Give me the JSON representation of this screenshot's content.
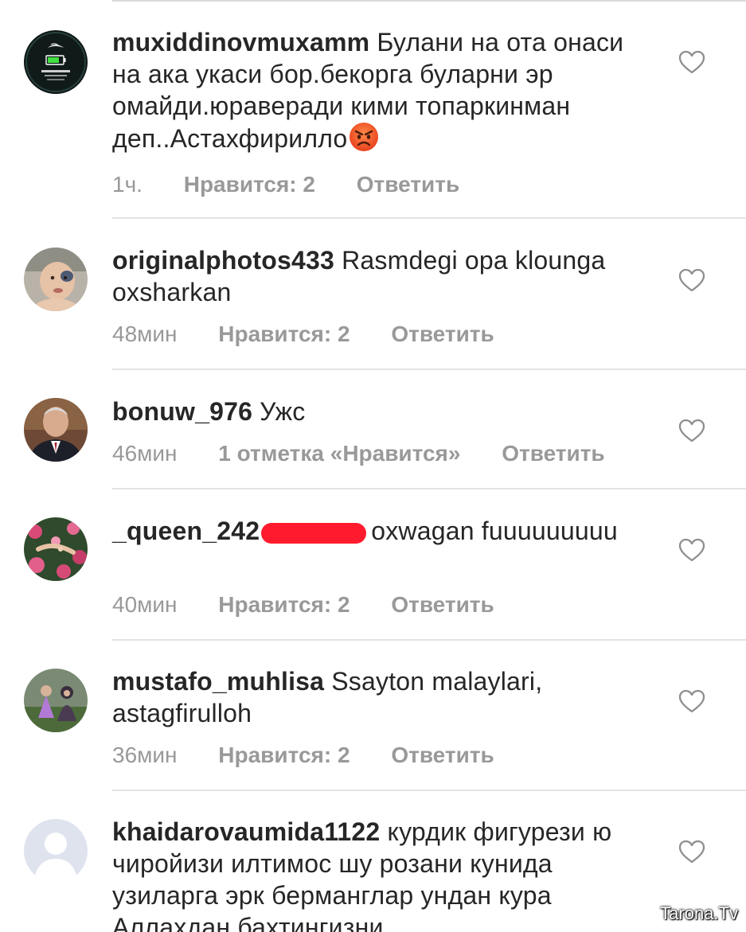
{
  "comments": [
    {
      "username": "muxiddinovmuxamm",
      "text": "Булани на ота онаси на ака укаси бор.бекорга буларни эр омайди.юраверади кими топаркинман деп..Астахфирилло",
      "emoji": "angry-face",
      "time": "1ч.",
      "likes": "Нравится: 2",
      "reply": "Ответить"
    },
    {
      "username": "originalphotos433",
      "text": "Rasmdegi opa klounga oxsharkan",
      "time": "48мин",
      "likes": "Нравится: 2",
      "reply": "Ответить"
    },
    {
      "username": "bonuw_976",
      "text": "Ужс",
      "time": "46мин",
      "likes": "1 отметка «Нравится»",
      "reply": "Ответить"
    },
    {
      "username": "_queen_242",
      "text": "oxwagan fuuuuuuuuu",
      "time": "40мин",
      "likes": "Нравится: 2",
      "reply": "Ответить"
    },
    {
      "username": "mustafo_muhlisa",
      "text": "Ssayton malaylari, astagfirulloh",
      "time": "36мин",
      "likes": "Нравится: 2",
      "reply": "Ответить"
    },
    {
      "username": "khaidarovaumida1122",
      "text": "курдик фигурези ю чиройизи илтимос шу розани кунида узиларга эрк берманглар ундан кура Аллахдан бахтингизни"
    }
  ],
  "watermark": "Tarona.Tv",
  "colors": {
    "text": "#262626",
    "meta": "#999999",
    "divider": "#e3e3e3",
    "redaction": "#ff1b2d"
  }
}
